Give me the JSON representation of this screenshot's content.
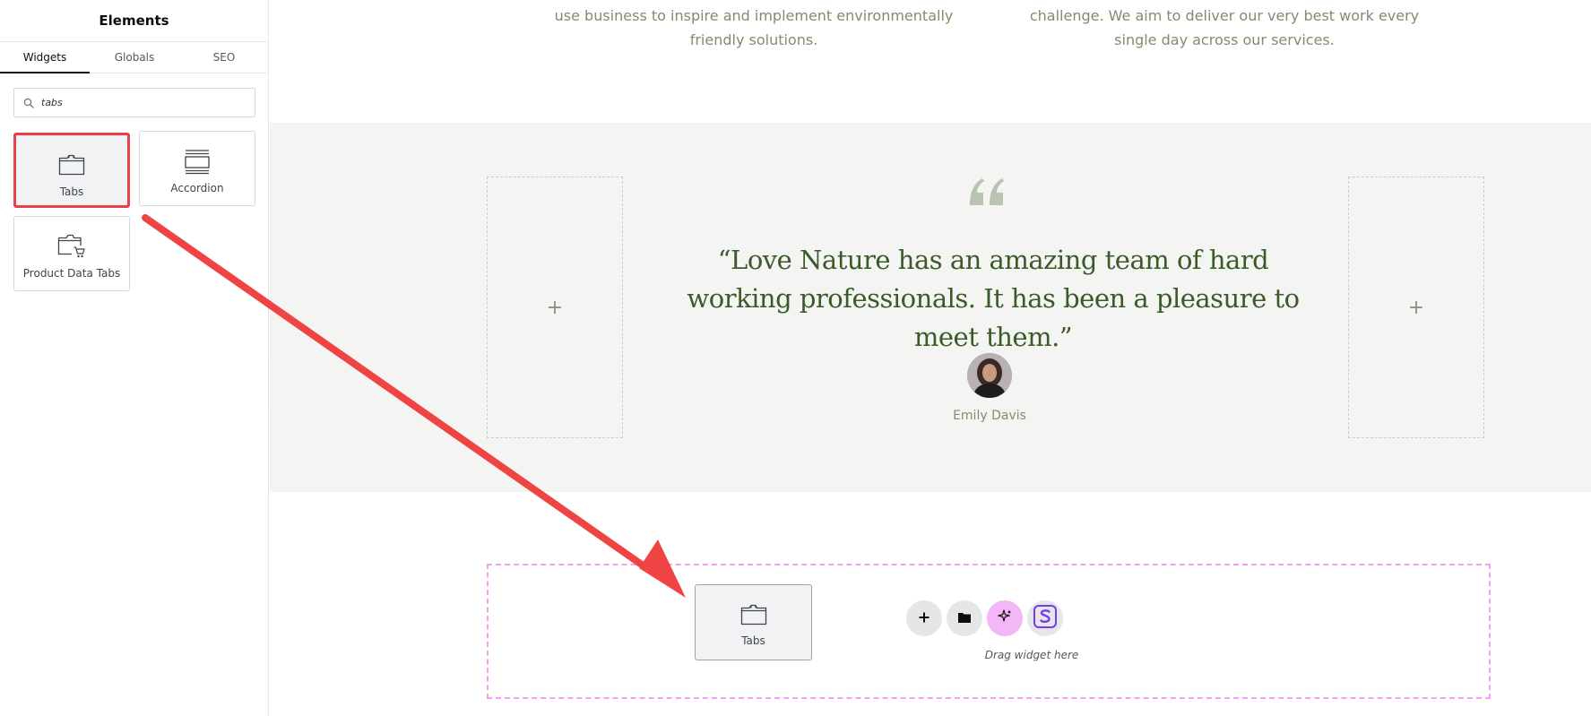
{
  "sidebar": {
    "title": "Elements",
    "tabs": [
      {
        "label": "Widgets",
        "active": true
      },
      {
        "label": "Globals",
        "active": false
      },
      {
        "label": "SEO",
        "active": false
      }
    ],
    "search": {
      "value": "tabs",
      "icon": "search-icon"
    },
    "results": [
      {
        "label": "Tabs",
        "icon": "folder-tabs-icon",
        "selected": true
      },
      {
        "label": "Accordion",
        "icon": "accordion-icon",
        "selected": false
      },
      {
        "label": "Product Data Tabs",
        "icon": "product-tabs-icon",
        "selected": false
      }
    ],
    "collapse_icon": "chevron-left-icon"
  },
  "canvas": {
    "top_text_left": "use business to inspire and implement environmentally friendly solutions.",
    "top_text_right": "challenge. We aim to deliver our very best work every single day across our services.",
    "testimonial": {
      "quote": "“Love Nature has an amazing team of hard working professionals. It has been a pleasure to meet them.”",
      "author": "Emily Davis",
      "placeholder_symbol": "+"
    },
    "dropzone": {
      "ghost_label": "Tabs",
      "hint": "Drag widget here",
      "buttons": [
        "add-section-button",
        "template-library-button",
        "ai-assistant-button",
        "starter-templates-button"
      ]
    }
  },
  "colors": {
    "accent_green": "#7e8e6e",
    "quote_green": "#3b5a2a",
    "selection_red": "#e6414b",
    "dropzone_pink": "#f0a2f0",
    "ai_button": "#f3b6f7",
    "arrow_red": "#ef4444"
  }
}
